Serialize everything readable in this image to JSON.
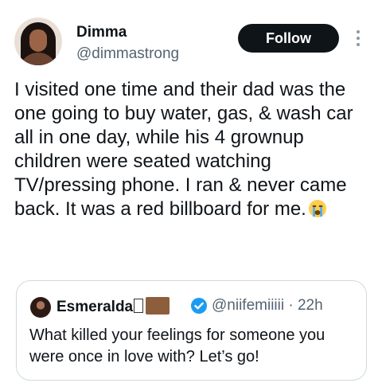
{
  "author": {
    "display_name": "Dimma",
    "handle": "@dimmastrong"
  },
  "follow_label": "Follow",
  "tweet": {
    "text": "I visited one time and their dad was the one going to buy water, gas, & wash car all in one day, while his 4 grownup children were seated watching TV/pressing phone. I ran & never came back. It was a red billboard for me.",
    "emoji": "loudly-crying-face"
  },
  "quoted": {
    "display_name": "Esmeralda",
    "handle": "@niifemiiiii",
    "separator": "·",
    "time": "22h",
    "text": "What killed your feelings for someone you were once in love with? Let’s go!"
  },
  "colors": {
    "primary_text": "#0f1419",
    "secondary_text": "#536471",
    "verified_blue": "#1d9bf0",
    "border": "#cfd9de"
  }
}
